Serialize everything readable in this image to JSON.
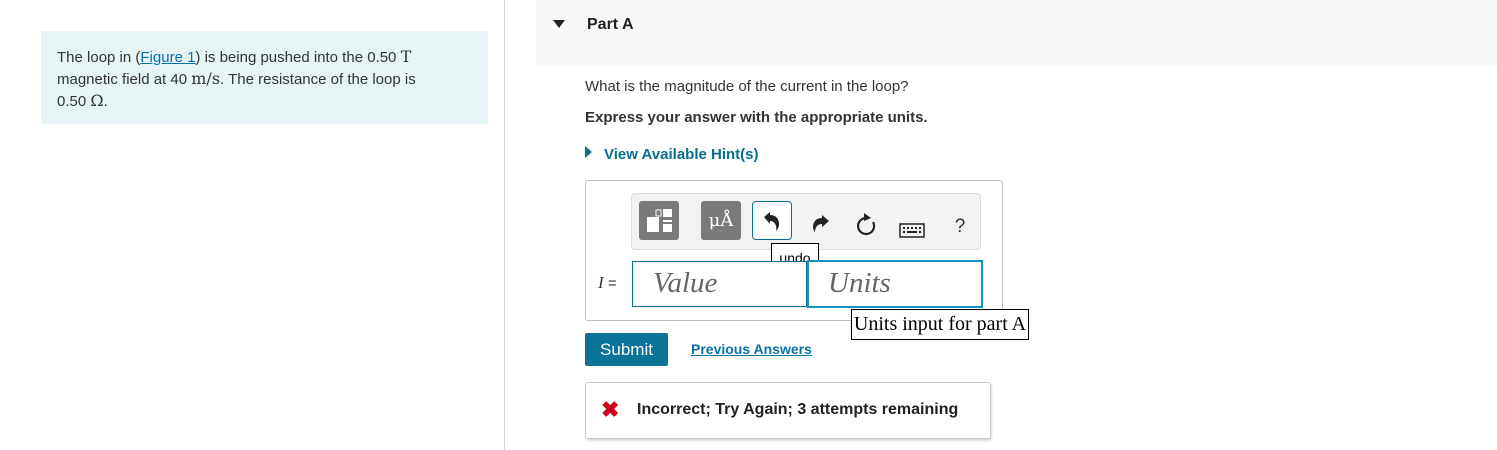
{
  "problem": {
    "text_before_link": "The loop in (",
    "figure_link": "Figure 1",
    "text_after_link": ") is being pushed into the 0.50 ",
    "unit_T": "T",
    "text_line2": "magnetic field at 40 ",
    "unit_speed": "m/s",
    "text_line2b": ". The resistance of the loop is",
    "text_line3": "0.50 ",
    "unit_ohm": "Ω",
    "text_end": "."
  },
  "part": {
    "title": "Part A",
    "question": "What is the magnitude of the current in the loop?",
    "instruction": "Express your answer with the appropriate units.",
    "hint_link": "View Available Hint(s)"
  },
  "toolbar": {
    "templates_icon": "templates-icon",
    "units_label": "μÅ",
    "undo_icon": "undo-icon",
    "redo_icon": "redo-icon",
    "reset_icon": "reset-icon",
    "keyboard_icon": "keyboard-icon",
    "help_label": "?"
  },
  "tooltips": {
    "undo": "undo",
    "units_input": "Units input for part A"
  },
  "answer": {
    "variable": "I",
    "equals": " =",
    "value_placeholder": "Value",
    "units_placeholder": "Units"
  },
  "actions": {
    "submit": "Submit",
    "previous_answers": "Previous Answers"
  },
  "feedback": {
    "icon": "✖",
    "message": "Incorrect; Try Again; 3 attempts remaining"
  },
  "colors": {
    "accent": "#0a7396",
    "error": "#d0021b",
    "problem_bg": "#e6f4f5"
  }
}
